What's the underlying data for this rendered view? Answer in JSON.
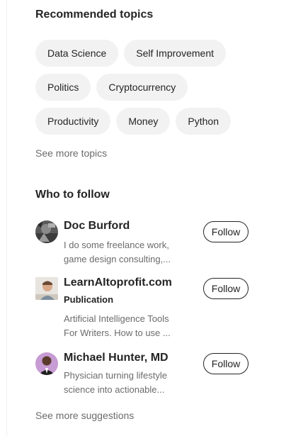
{
  "recommended_topics": {
    "title": "Recommended topics",
    "topics": [
      "Data Science",
      "Self Improvement",
      "Politics",
      "Cryptocurrency",
      "Productivity",
      "Money",
      "Python"
    ],
    "see_more": "See more topics"
  },
  "who_to_follow": {
    "title": "Who to follow",
    "people": [
      {
        "name": "Doc Burford",
        "subtitle": "",
        "bio_line1": "I do some freelance work,",
        "bio_line2": "game design consulting,...",
        "follow_label": "Follow"
      },
      {
        "name": "LearnAItoprofit.com",
        "subtitle": "Publication",
        "bio_line1": "Artificial Intelligence Tools",
        "bio_line2": "For Writers. How to use ...",
        "follow_label": "Follow"
      },
      {
        "name": "Michael Hunter, MD",
        "subtitle": "",
        "bio_line1": "Physician turning lifestyle",
        "bio_line2": "science into actionable...",
        "follow_label": "Follow"
      }
    ],
    "see_more": "See more suggestions"
  },
  "colors": {
    "chip_bg": "#f2f2f2",
    "text_primary": "#242424",
    "text_secondary": "#6b6b6b"
  }
}
